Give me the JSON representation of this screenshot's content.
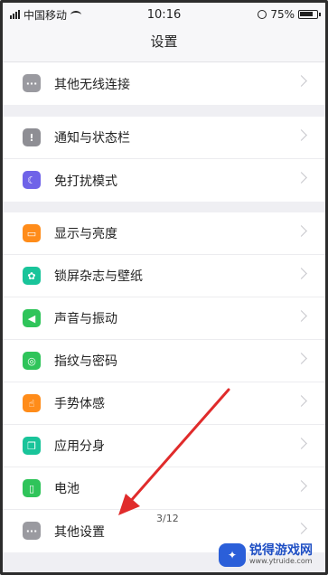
{
  "status_bar": {
    "carrier": "中国移动",
    "time": "10:16",
    "battery": "75%",
    "icons": [
      "signal-icon",
      "wifi-icon",
      "alarm-icon",
      "battery-icon"
    ]
  },
  "header": {
    "title": "设置"
  },
  "groups": [
    {
      "items": [
        {
          "label": "其他无线连接",
          "icon": "more-icon",
          "color": "#9a9aa0",
          "glyph": "···"
        }
      ]
    },
    {
      "items": [
        {
          "label": "通知与状态栏",
          "icon": "notification-icon",
          "color": "#8e8e94",
          "glyph": "!"
        },
        {
          "label": "免打扰模式",
          "icon": "moon-icon",
          "color": "#6f63e8",
          "glyph": "☾"
        }
      ]
    },
    {
      "items": [
        {
          "label": "显示与亮度",
          "icon": "display-icon",
          "color": "#ff8c1a",
          "glyph": "▭"
        },
        {
          "label": "锁屏杂志与壁纸",
          "icon": "flower-icon",
          "color": "#19c49a",
          "glyph": "✿"
        },
        {
          "label": "声音与振动",
          "icon": "speaker-icon",
          "color": "#2fc45a",
          "glyph": "◀"
        },
        {
          "label": "指纹与密码",
          "icon": "fingerprint-icon",
          "color": "#2fc45a",
          "glyph": "◎"
        },
        {
          "label": "手势体感",
          "icon": "hand-icon",
          "color": "#ff8c1a",
          "glyph": "☝"
        },
        {
          "label": "应用分身",
          "icon": "clone-icon",
          "color": "#19c49a",
          "glyph": "❐"
        },
        {
          "label": "电池",
          "icon": "battery-icon",
          "color": "#2fc45a",
          "glyph": "▯"
        },
        {
          "label": "其他设置",
          "icon": "more-icon",
          "color": "#9a9aa0",
          "glyph": "···"
        }
      ]
    }
  ],
  "page_indicator": "3/12",
  "watermark": {
    "title": "锐得游戏网",
    "subtitle": "www.ytruide.com"
  }
}
